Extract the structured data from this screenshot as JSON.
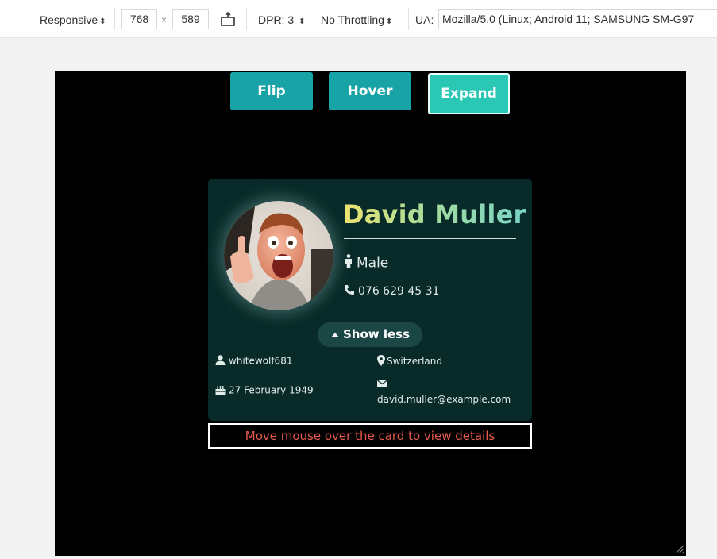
{
  "toolbar": {
    "device": "Responsive",
    "width": "768",
    "times": "×",
    "height": "589",
    "dpr": "DPR: 3",
    "throttling": "No Throttling",
    "ua_label": "UA:",
    "ua_value": "Mozilla/5.0 (Linux; Android 11; SAMSUNG SM-G97"
  },
  "modes": {
    "flip": "Flip",
    "hover": "Hover",
    "expand": "Expand",
    "active": "Expand"
  },
  "profile": {
    "name": "David Muller",
    "gender": "Male",
    "phone": "076 629 45 31",
    "toggle_label": "Show less",
    "username": "whitewolf681",
    "location": "Switzerland",
    "birthday": "27 February 1949",
    "email": "david.muller@example.com"
  },
  "hint": "Move mouse over the card to view details",
  "colors": {
    "viewport_bg": "#000000",
    "button": "#18a3a6",
    "button_active": "#2ac8b4",
    "card_bg": "#082a28",
    "hint_text": "#e85a4f",
    "name_gradient_start": "#ede370",
    "name_gradient_end": "#77d4c6"
  },
  "icons": {
    "gender": "male-icon",
    "phone": "phone-icon",
    "toggle": "caret-up-icon",
    "username": "user-icon",
    "location": "map-marker-icon",
    "birthday": "birthday-cake-icon",
    "email": "envelope-icon"
  }
}
